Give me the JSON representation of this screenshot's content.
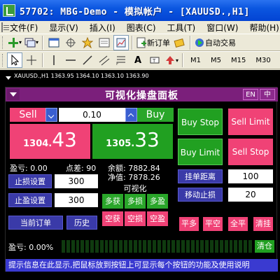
{
  "window": {
    "title": "57702: MBG-Demo - 模拟帐户 - [XAUUSD.,H1]"
  },
  "menu": {
    "items": [
      "文件(F)",
      "显示(V)",
      "插入(I)",
      "图表(C)",
      "工具(T)",
      "窗口(W)",
      "帮助(H)"
    ]
  },
  "toolbar": {
    "new_order_label": "新订单",
    "auto_trade_label": "自动交易",
    "timeframes": [
      "M1",
      "M5",
      "M15",
      "M30"
    ]
  },
  "chart": {
    "header": "XAUUSD.,H1  1363.95 1364.10 1363.10 1363.90"
  },
  "panel": {
    "title": "可视化操盘面板",
    "lang_en": "EN",
    "lang_zh": "中",
    "sell_label": "Sell",
    "buy_label": "Buy",
    "lot_value": "0.10",
    "sell_price_small": "1304.",
    "sell_price_big": "43",
    "buy_price_small": "1305.",
    "buy_price_big": "33",
    "profit_label": "盈亏: 0.00",
    "spread_label": "点差: 90",
    "balance_label": "余额: 7882.84",
    "equity_label": "净值: 7878.26",
    "stop_loss_label": "止损设置",
    "stop_loss_value": "300",
    "take_profit_label": "止盈设置",
    "take_profit_value": "300",
    "current_orders_label": "当前订单",
    "history_label": "历史",
    "visual_title": "可视化",
    "visual_buttons": [
      "多获",
      "多损",
      "多盈",
      "空获",
      "空损",
      "空盈"
    ],
    "buy_stop_label": "Buy Stop",
    "sell_limit_label": "Sell Limit",
    "buy_limit_label": "Buy Limit",
    "sell_stop_label": "Sell Stop",
    "pending_distance_label": "挂单距离",
    "pending_distance_value": "100",
    "trailing_stop_label": "移动止损",
    "trailing_stop_value": "20",
    "close_long_label": "平多",
    "close_short_label": "平空",
    "close_all_trades_label": "全平",
    "clear_pending_label": "清挂",
    "pnl_percent_label": "盈亏: 0.00%",
    "close_all_label": "清仓",
    "tip_text": "提示信息在此显示,把鼠标放到按钮上可显示每个按钮的功能及使用说明"
  }
}
